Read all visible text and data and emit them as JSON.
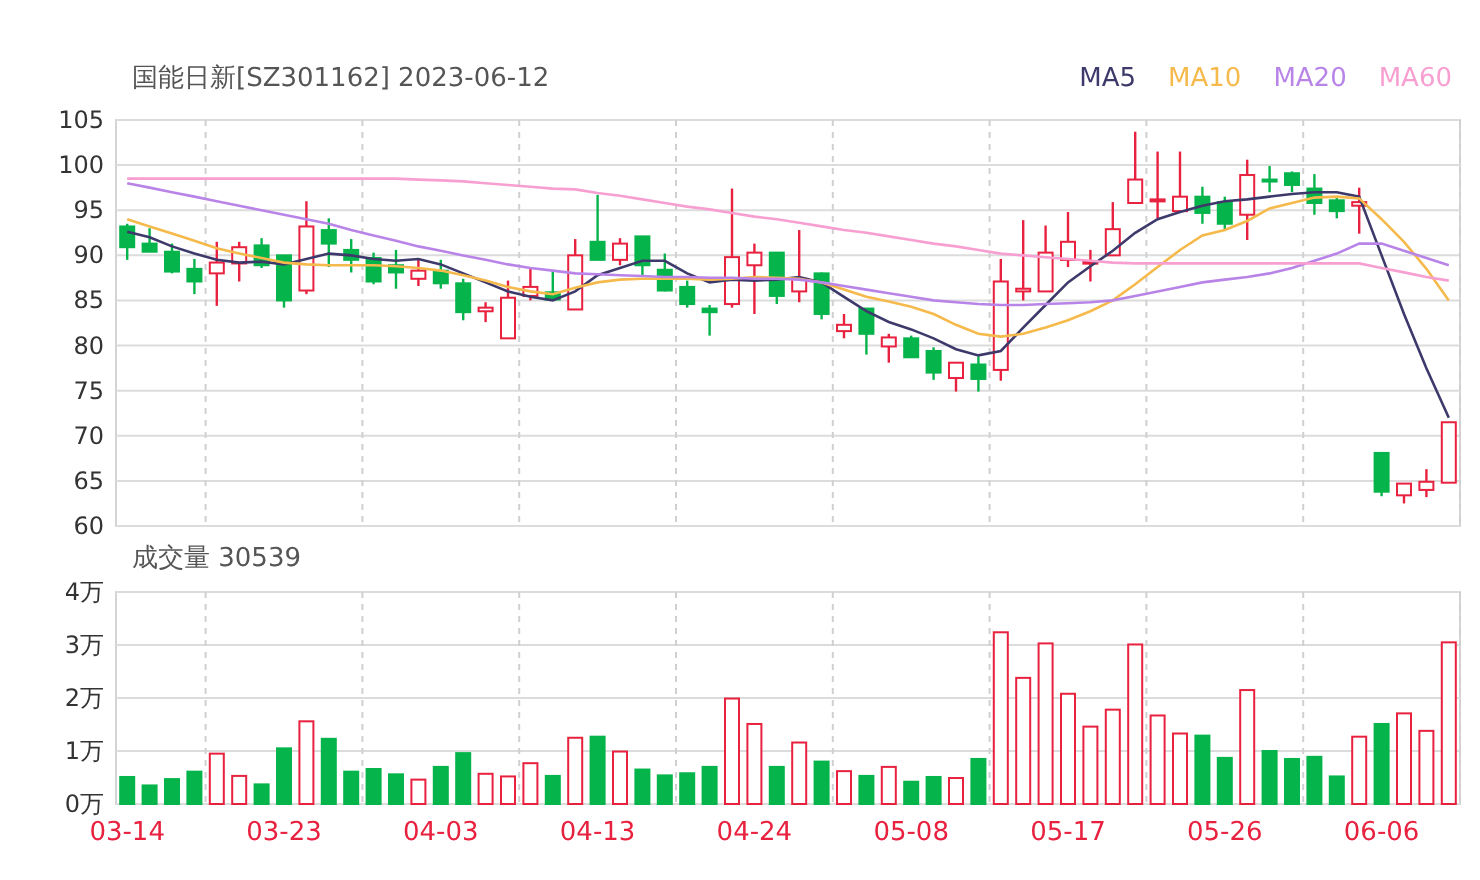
{
  "price_chart": {
    "chart_data": {
      "type": "candlestick",
      "title": "国能日新[SZ301162] 2023-06-12",
      "grid": true,
      "ylim": [
        60,
        105
      ],
      "yticks": [
        60,
        65,
        70,
        75,
        80,
        85,
        90,
        95,
        100,
        105
      ],
      "categories": [
        null,
        null,
        null,
        null,
        null,
        null,
        null,
        null,
        null,
        null,
        null,
        null,
        null,
        null,
        null,
        null,
        null,
        null,
        null,
        null,
        null,
        null,
        null,
        null,
        null,
        null,
        null,
        null,
        null,
        null,
        null,
        null,
        null,
        null,
        null,
        null,
        null,
        null,
        null,
        null,
        null,
        null,
        null,
        null,
        null,
        null,
        null,
        null,
        null,
        null,
        null,
        null,
        null,
        null,
        null,
        null,
        null,
        null,
        null,
        null
      ],
      "ohlc": [
        [
          93.2,
          93.5,
          89.5,
          90.9
        ],
        [
          91.3,
          93,
          90.4,
          90.4
        ],
        [
          90.4,
          91.3,
          88,
          88.2
        ],
        [
          88.5,
          89.6,
          85.7,
          87.1
        ],
        [
          88,
          91.5,
          84.4,
          89.2
        ],
        [
          89.1,
          91.5,
          87.1,
          90.9
        ],
        [
          91.1,
          91.9,
          88.6,
          88.9
        ],
        [
          90,
          90,
          84.2,
          85
        ],
        [
          86.1,
          96,
          85.7,
          93.2
        ],
        [
          92.8,
          94.1,
          88.7,
          91.3
        ],
        [
          90.6,
          91.8,
          88.1,
          89.5
        ],
        [
          89.7,
          90.3,
          86.8,
          87.1
        ],
        [
          88.9,
          90.6,
          86.3,
          88.1
        ],
        [
          87.4,
          89.5,
          86.6,
          88.3
        ],
        [
          88.3,
          89.5,
          86.3,
          86.9
        ],
        [
          86.9,
          87.4,
          82.8,
          83.7
        ],
        [
          83.8,
          84.8,
          82.6,
          84.2
        ],
        [
          80.8,
          87.2,
          80.8,
          85.3
        ],
        [
          85.5,
          88.5,
          85,
          86.5
        ],
        [
          85.9,
          88.3,
          85.1,
          85.1
        ],
        [
          84,
          91.8,
          84,
          90
        ],
        [
          91.5,
          96.7,
          89.5,
          89.5
        ],
        [
          89.5,
          91.9,
          88.9,
          91.3
        ],
        [
          92.1,
          92.1,
          87.8,
          88.9
        ],
        [
          88.4,
          90.2,
          86,
          86.1
        ],
        [
          86.5,
          87.2,
          84.2,
          84.6
        ],
        [
          84.1,
          84.5,
          81.1,
          83.7
        ],
        [
          84.6,
          97.4,
          84.2,
          89.8
        ],
        [
          88.9,
          91.3,
          83.5,
          90.3
        ],
        [
          90.3,
          90.3,
          84.6,
          85.5
        ],
        [
          86,
          92.8,
          84.8,
          87.4
        ],
        [
          88,
          88.1,
          82.9,
          83.5
        ],
        [
          81.6,
          83.5,
          80.8,
          82.3
        ],
        [
          84.1,
          84.1,
          79,
          81.3
        ],
        [
          79.9,
          81.3,
          78.1,
          80.9
        ],
        [
          80.8,
          81.1,
          78.7,
          78.7
        ],
        [
          79.4,
          79.8,
          76.2,
          77
        ],
        [
          76.4,
          78.1,
          74.9,
          78.1
        ],
        [
          77.9,
          78.8,
          74.9,
          76.3
        ],
        [
          77.3,
          89.6,
          76.1,
          87.1
        ],
        [
          86,
          93.9,
          85,
          86.3
        ],
        [
          86,
          93.3,
          86,
          90.3
        ],
        [
          89.5,
          94.8,
          88.7,
          91.5
        ],
        [
          89.1,
          90.6,
          87.1,
          89.3
        ],
        [
          90,
          95.9,
          90,
          92.9
        ],
        [
          95.8,
          103.7,
          95.8,
          98.4
        ],
        [
          96.1,
          101.5,
          94.1,
          96.2
        ],
        [
          94.9,
          101.5,
          94.9,
          96.5
        ],
        [
          96.5,
          97.6,
          93.5,
          94.7
        ],
        [
          95.9,
          96.5,
          92.9,
          93.5
        ],
        [
          94.5,
          100.6,
          91.7,
          98.9
        ],
        [
          98.4,
          99.9,
          97,
          98.2
        ],
        [
          99.1,
          99.3,
          97,
          97.8
        ],
        [
          97.4,
          99,
          94.5,
          95.8
        ],
        [
          96.1,
          96.5,
          94.1,
          94.9
        ],
        [
          95.5,
          97.5,
          92.4,
          95.9
        ],
        [
          68.1,
          68.1,
          63.3,
          63.8
        ],
        [
          63.4,
          64.7,
          62.5,
          64.7
        ],
        [
          64,
          66.3,
          63.2,
          64.9
        ],
        [
          64.8,
          71.5,
          64.8,
          71.5
        ]
      ],
      "series": [
        {
          "name": "MA5",
          "type": "line",
          "color": "#3d3a6b",
          "values": [
            92.6,
            92,
            91,
            90.2,
            89.5,
            89.2,
            89.3,
            89,
            89.6,
            90.2,
            90,
            89.6,
            89.4,
            89.6,
            89,
            88,
            87,
            86,
            85.4,
            85,
            86,
            87.8,
            88.6,
            89.4,
            89.4,
            88,
            87,
            87.3,
            87.2,
            87.3,
            87.6,
            87,
            85.4,
            83.8,
            82.6,
            81.8,
            80.8,
            79.6,
            78.9,
            79.4,
            82,
            84.5,
            87,
            88.8,
            90.5,
            92.5,
            94,
            94.8,
            95.5,
            96,
            96.2,
            96.5,
            96.8,
            97,
            97,
            96.5,
            90,
            83.5,
            77.5,
            72
          ]
        },
        {
          "name": "MA10",
          "type": "line",
          "color": "#f5b94c",
          "values": [
            94,
            93.2,
            92.4,
            91.6,
            90.8,
            90.2,
            89.7,
            89.2,
            89,
            88.9,
            88.9,
            88.9,
            88.8,
            88.6,
            88.3,
            87.8,
            87.2,
            86.5,
            86,
            85.7,
            86.4,
            87,
            87.3,
            87.4,
            87.4,
            87.4,
            87.3,
            87.4,
            87.6,
            87.5,
            87.4,
            87,
            86.2,
            85.4,
            84.9,
            84.3,
            83.5,
            82.3,
            81.3,
            81,
            81.3,
            82,
            82.8,
            83.8,
            85,
            86.8,
            88.7,
            90.6,
            92.2,
            92.8,
            93.8,
            95.2,
            95.8,
            96.4,
            96.5,
            96.3,
            94,
            91.5,
            88.5,
            85
          ]
        },
        {
          "name": "MA20",
          "type": "line",
          "color": "#b984e8",
          "values": [
            98,
            97.5,
            97,
            96.5,
            96,
            95.5,
            95,
            94.5,
            94,
            93.5,
            92.8,
            92.2,
            91.6,
            91,
            90.5,
            90,
            89.5,
            89,
            88.6,
            88.3,
            88,
            87.9,
            87.8,
            87.7,
            87.6,
            87.6,
            87.5,
            87.5,
            87.4,
            87.4,
            87.3,
            87,
            86.6,
            86.2,
            85.8,
            85.4,
            85,
            84.8,
            84.6,
            84.5,
            84.5,
            84.6,
            84.7,
            84.8,
            85,
            85.5,
            86,
            86.5,
            87,
            87.3,
            87.6,
            88,
            88.6,
            89.4,
            90.2,
            91.3,
            91.3,
            90.5,
            89.7,
            88.9
          ]
        },
        {
          "name": "MA60",
          "type": "line",
          "color": "#f79fd0",
          "values": [
            98.5,
            98.5,
            98.5,
            98.5,
            98.5,
            98.5,
            98.5,
            98.5,
            98.5,
            98.5,
            98.5,
            98.5,
            98.5,
            98.4,
            98.3,
            98.2,
            98,
            97.8,
            97.6,
            97.4,
            97.3,
            96.9,
            96.6,
            96.2,
            95.8,
            95.4,
            95.1,
            94.7,
            94.3,
            94,
            93.6,
            93.2,
            92.8,
            92.5,
            92.1,
            91.7,
            91.3,
            91,
            90.6,
            90.2,
            90,
            89.8,
            89.6,
            89.4,
            89.2,
            89.1,
            89.1,
            89.1,
            89.1,
            89.1,
            89.1,
            89.1,
            89.1,
            89.1,
            89.1,
            89.1,
            88.6,
            88.1,
            87.6,
            87.2
          ]
        }
      ]
    }
  },
  "volume_chart": {
    "chart_data": {
      "type": "bar",
      "title": "成交量 30539",
      "grid": true,
      "ylim": [
        0,
        4
      ],
      "yticks": [
        {
          "value": 0,
          "label": "0万"
        },
        {
          "value": 1,
          "label": "1万"
        },
        {
          "value": 2,
          "label": "2万"
        },
        {
          "value": 3,
          "label": "3万"
        },
        {
          "value": 4,
          "label": "4万"
        }
      ],
      "categories": [
        "03-14",
        null,
        null,
        null,
        null,
        null,
        null,
        "03-23",
        null,
        null,
        null,
        null,
        null,
        null,
        "04-03",
        null,
        null,
        null,
        null,
        null,
        null,
        "04-13",
        null,
        null,
        null,
        null,
        null,
        null,
        "04-24",
        null,
        null,
        null,
        null,
        null,
        null,
        "05-08",
        null,
        null,
        null,
        null,
        null,
        null,
        "05-17",
        null,
        null,
        null,
        null,
        null,
        null,
        "05-26",
        null,
        null,
        null,
        null,
        null,
        null,
        "06-06",
        null,
        null,
        null
      ],
      "values": [
        0.51,
        0.35,
        0.47,
        0.61,
        0.95,
        0.53,
        0.37,
        1.05,
        1.56,
        1.23,
        0.61,
        0.66,
        0.56,
        0.46,
        0.7,
        0.96,
        0.57,
        0.52,
        0.77,
        0.53,
        1.25,
        1.27,
        0.99,
        0.65,
        0.54,
        0.58,
        0.7,
        1.99,
        1.51,
        0.7,
        1.16,
        0.8,
        0.62,
        0.53,
        0.7,
        0.42,
        0.51,
        0.49,
        0.85,
        3.24,
        2.38,
        3.03,
        2.08,
        1.46,
        1.78,
        3.01,
        1.67,
        1.33,
        1.29,
        0.87,
        2.15,
        1,
        0.85,
        0.89,
        0.52,
        1.27,
        1.51,
        1.71,
        1.38,
        3.05
      ]
    }
  }
}
